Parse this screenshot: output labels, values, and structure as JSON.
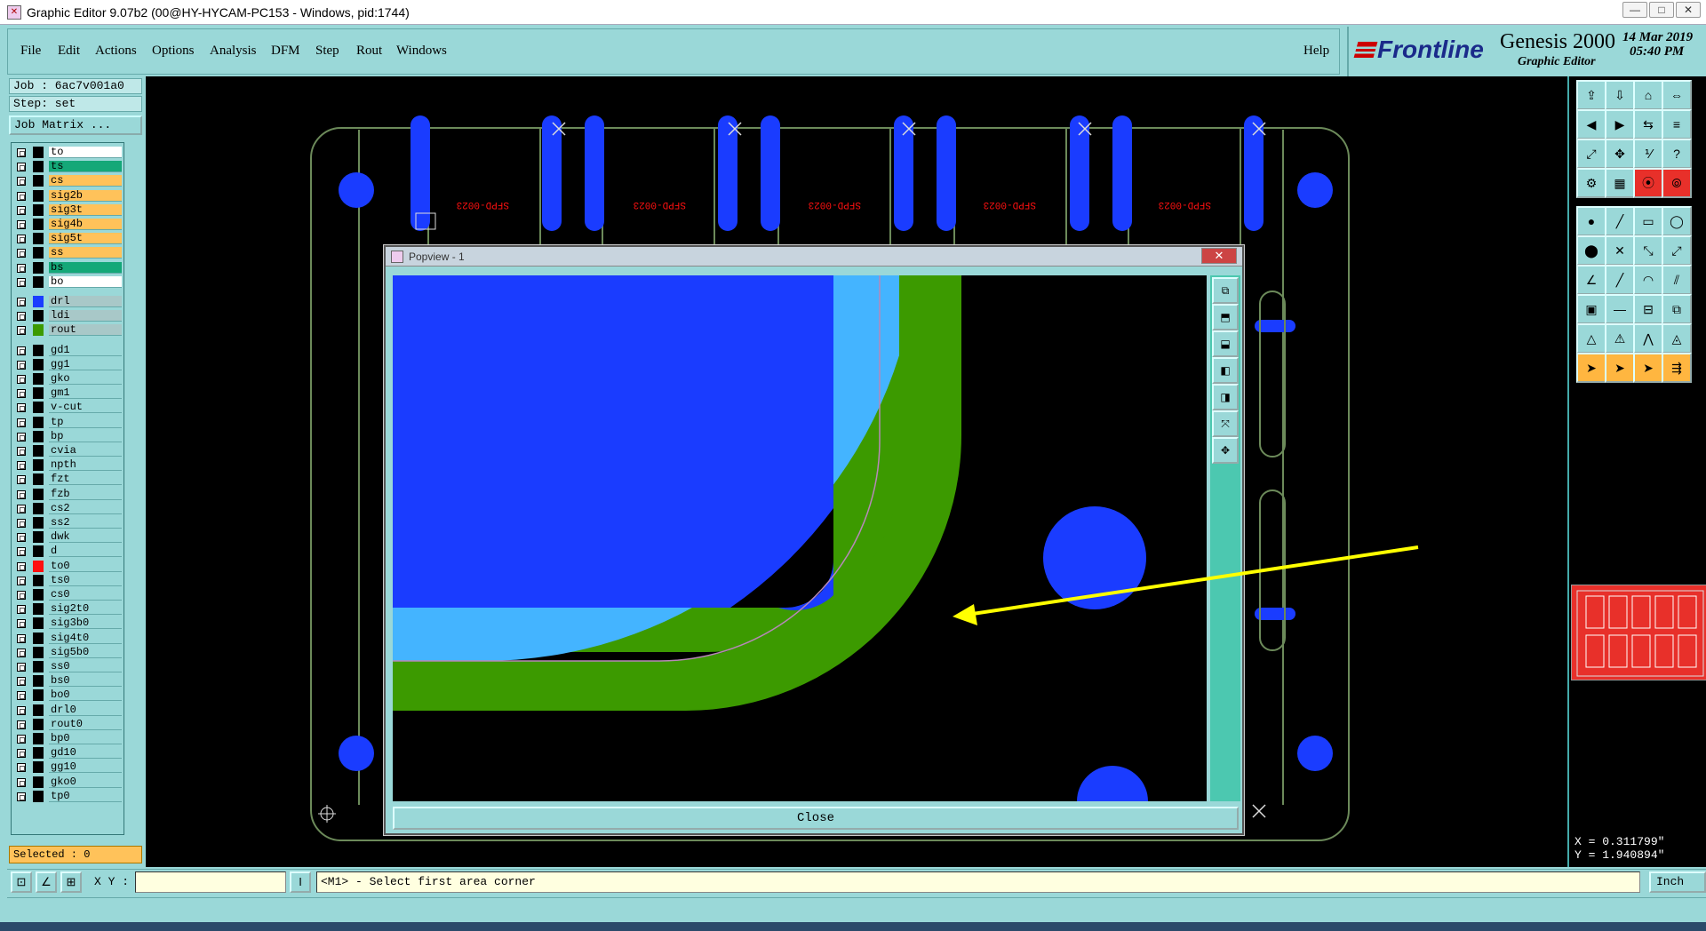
{
  "window": {
    "title": "Graphic Editor 9.07b2 (00@HY-HYCAM-PC153 - Windows, pid:1744)",
    "minimize": "—",
    "maximize": "□",
    "close": "✕"
  },
  "menu": [
    "File",
    "Edit",
    "Actions",
    "Options",
    "Analysis",
    "DFM",
    "Step",
    "Rout",
    "Windows"
  ],
  "help": "Help",
  "brand": {
    "logo": "Frontline",
    "product": "Genesis 2000",
    "subtitle": "Graphic Editor",
    "date": "14 Mar 2019",
    "time": "05:40 PM"
  },
  "job": {
    "job_label": "Job : 6ac7v001a0",
    "step_label": "Step: set",
    "matrix_button": "Job Matrix ..."
  },
  "layers": [
    {
      "name": "to",
      "color": "#ffffff",
      "swatch": "#000000"
    },
    {
      "name": "ts",
      "color": "#14a878",
      "swatch": "#000000"
    },
    {
      "name": "cs",
      "color": "#ffc25a",
      "swatch": "#000000"
    },
    {
      "name": "sig2b",
      "color": "#ffc25a",
      "swatch": "#000000"
    },
    {
      "name": "sig3t",
      "color": "#ffc25a",
      "swatch": "#000000"
    },
    {
      "name": "sig4b",
      "color": "#ffc25a",
      "swatch": "#000000"
    },
    {
      "name": "sig5t",
      "color": "#ffc25a",
      "swatch": "#000000"
    },
    {
      "name": "ss",
      "color": "#ffc25a",
      "swatch": "#000000"
    },
    {
      "name": "bs",
      "color": "#14a878",
      "swatch": "#000000"
    },
    {
      "name": "bo",
      "color": "#ffffff",
      "swatch": "#000000"
    },
    {
      "name": "drl",
      "color": "#a8c8c8",
      "swatch": "#1a3cff"
    },
    {
      "name": "ldi",
      "color": "#a8c8c8",
      "swatch": "#000000"
    },
    {
      "name": "rout",
      "color": "#a8c8c8",
      "swatch": "#3c9a00"
    },
    {
      "name": "gd1",
      "color": "#9ad8d8",
      "swatch": "#000000"
    },
    {
      "name": "gg1",
      "color": "#9ad8d8",
      "swatch": "#000000"
    },
    {
      "name": "gko",
      "color": "#9ad8d8",
      "swatch": "#000000"
    },
    {
      "name": "gm1",
      "color": "#9ad8d8",
      "swatch": "#000000"
    },
    {
      "name": "v-cut",
      "color": "#9ad8d8",
      "swatch": "#000000"
    },
    {
      "name": "tp",
      "color": "#9ad8d8",
      "swatch": "#000000"
    },
    {
      "name": "bp",
      "color": "#9ad8d8",
      "swatch": "#000000"
    },
    {
      "name": "cvia",
      "color": "#9ad8d8",
      "swatch": "#000000"
    },
    {
      "name": "npth",
      "color": "#9ad8d8",
      "swatch": "#000000"
    },
    {
      "name": "fzt",
      "color": "#9ad8d8",
      "swatch": "#000000"
    },
    {
      "name": "fzb",
      "color": "#9ad8d8",
      "swatch": "#000000"
    },
    {
      "name": "cs2",
      "color": "#9ad8d8",
      "swatch": "#000000"
    },
    {
      "name": "ss2",
      "color": "#9ad8d8",
      "swatch": "#000000"
    },
    {
      "name": "dwk",
      "color": "#9ad8d8",
      "swatch": "#000000"
    },
    {
      "name": "d",
      "color": "#9ad8d8",
      "swatch": "#000000"
    },
    {
      "name": "to0",
      "color": "#9ad8d8",
      "swatch": "#ff1010"
    },
    {
      "name": "ts0",
      "color": "#9ad8d8",
      "swatch": "#000000"
    },
    {
      "name": "cs0",
      "color": "#9ad8d8",
      "swatch": "#000000"
    },
    {
      "name": "sig2t0",
      "color": "#9ad8d8",
      "swatch": "#000000"
    },
    {
      "name": "sig3b0",
      "color": "#9ad8d8",
      "swatch": "#000000"
    },
    {
      "name": "sig4t0",
      "color": "#9ad8d8",
      "swatch": "#000000"
    },
    {
      "name": "sig5b0",
      "color": "#9ad8d8",
      "swatch": "#000000"
    },
    {
      "name": "ss0",
      "color": "#9ad8d8",
      "swatch": "#000000"
    },
    {
      "name": "bs0",
      "color": "#9ad8d8",
      "swatch": "#000000"
    },
    {
      "name": "bo0",
      "color": "#9ad8d8",
      "swatch": "#000000"
    },
    {
      "name": "drl0",
      "color": "#9ad8d8",
      "swatch": "#000000"
    },
    {
      "name": "rout0",
      "color": "#9ad8d8",
      "swatch": "#000000"
    },
    {
      "name": "bp0",
      "color": "#9ad8d8",
      "swatch": "#000000"
    },
    {
      "name": "gd10",
      "color": "#9ad8d8",
      "swatch": "#000000"
    },
    {
      "name": "gg10",
      "color": "#9ad8d8",
      "swatch": "#000000"
    },
    {
      "name": "gko0",
      "color": "#9ad8d8",
      "swatch": "#000000"
    },
    {
      "name": "tp0",
      "color": "#9ad8d8",
      "swatch": "#000000"
    }
  ],
  "selected": "Selected : 0",
  "board_label": "SFPD-0023",
  "popview": {
    "title": "Popview - 1",
    "close_x": "✕",
    "close_button": "Close"
  },
  "coords": {
    "x": "X = 0.311799\"",
    "y": "Y = 1.940894\""
  },
  "status": {
    "xy_label": "X Y :",
    "xy_value": "",
    "prompt": "<M1> - Select first area corner",
    "units": "Inch"
  },
  "colors": {
    "panel": "#9ad8d8",
    "blue_pad": "#1a3cff",
    "light_blue": "#44b4ff",
    "green_rout": "#3c9a00",
    "arrow": "#ffff00",
    "red_text": "#ff1010"
  }
}
